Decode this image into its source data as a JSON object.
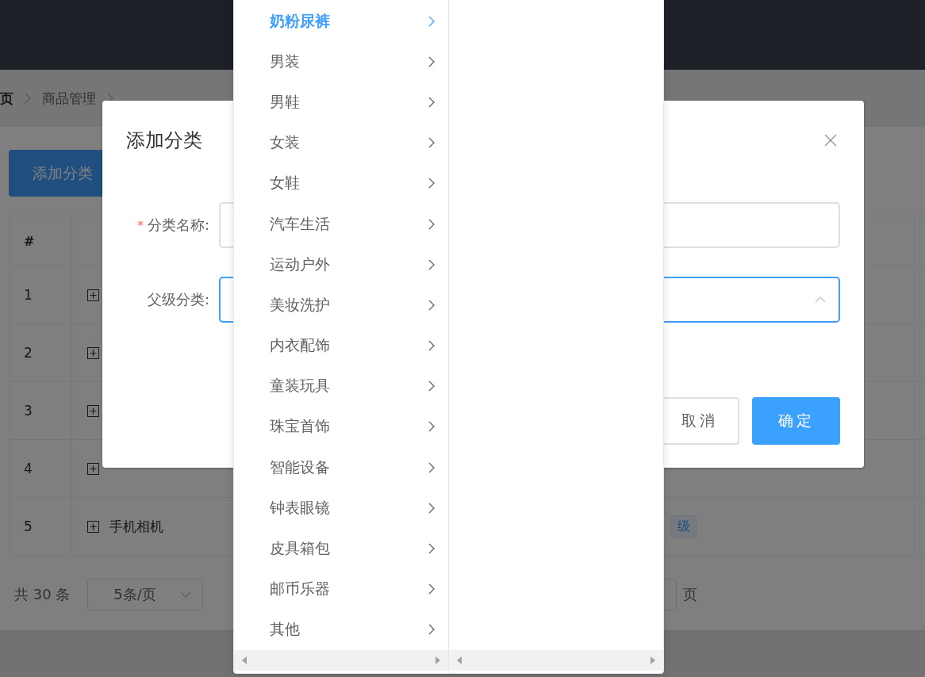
{
  "breadcrumb": [
    "页",
    "商品管理"
  ],
  "add_button": "添加分类",
  "table": {
    "columns": [
      "#"
    ],
    "rows": [
      {
        "index": "1"
      },
      {
        "index": "2"
      },
      {
        "index": "3"
      },
      {
        "index": "4"
      },
      {
        "index": "5",
        "name": "手机相机",
        "level_tag": "级"
      }
    ]
  },
  "pagination": {
    "total": "共 30 条",
    "page_size": "5条/页",
    "page_suffix": "页"
  },
  "dialog": {
    "title": "添加分类",
    "fields": [
      {
        "kind": "input",
        "required_mark": "*",
        "label": "分类名称:",
        "focused": false
      },
      {
        "kind": "cascader",
        "label": "父级分类:",
        "focused": true
      }
    ],
    "buttons": [
      {
        "kind": "default",
        "label": "取消"
      },
      {
        "kind": "primary",
        "label": "确定"
      }
    ]
  },
  "cascader": {
    "second_panel": true,
    "items": [
      {
        "label": "奶粉尿裤",
        "selected": true
      },
      {
        "label": "男装",
        "selected": false
      },
      {
        "label": "男鞋",
        "selected": false
      },
      {
        "label": "女装",
        "selected": false
      },
      {
        "label": "女鞋",
        "selected": false
      },
      {
        "label": "汽车生活",
        "selected": false
      },
      {
        "label": "运动户外",
        "selected": false
      },
      {
        "label": "美妆洗护",
        "selected": false
      },
      {
        "label": "内衣配饰",
        "selected": false
      },
      {
        "label": "童装玩具",
        "selected": false
      },
      {
        "label": "珠宝首饰",
        "selected": false
      },
      {
        "label": "智能设备",
        "selected": false
      },
      {
        "label": "钟表眼镜",
        "selected": false
      },
      {
        "label": "皮具箱包",
        "selected": false
      },
      {
        "label": "邮币乐器",
        "selected": false
      },
      {
        "label": "其他",
        "selected": false
      }
    ]
  }
}
